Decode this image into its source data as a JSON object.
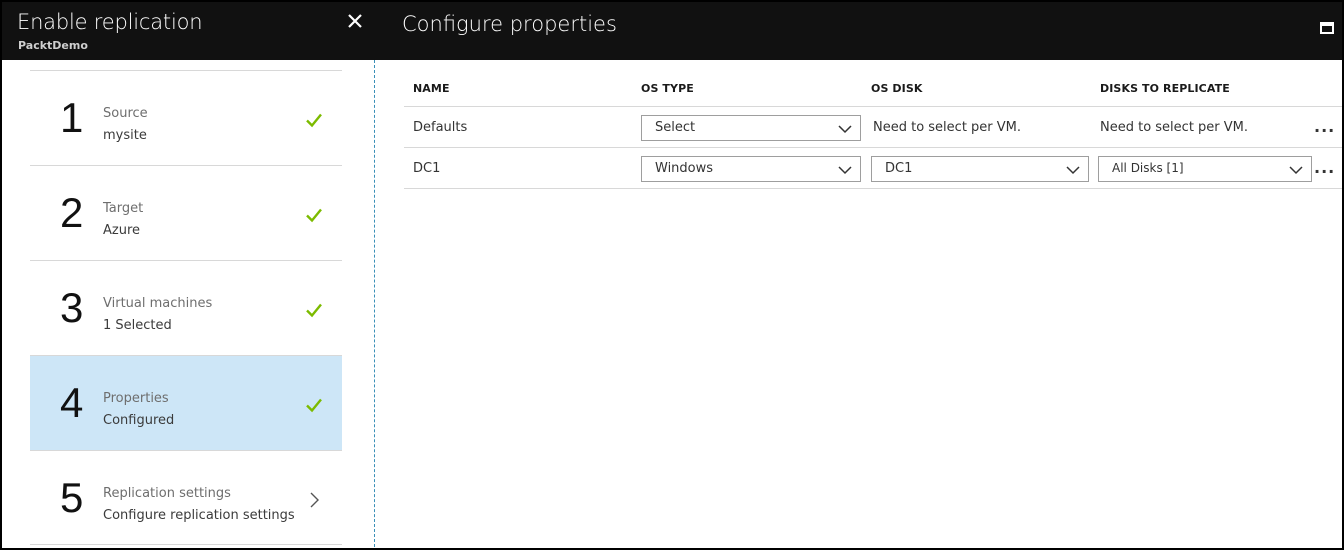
{
  "left_blade": {
    "title": "Enable replication",
    "subtitle": "PacktDemo",
    "close_icon": "close-icon",
    "steps": [
      {
        "number": "1",
        "label": "Source",
        "value": "mysite",
        "status": "done",
        "icon": "checkmark-icon"
      },
      {
        "number": "2",
        "label": "Target",
        "value": "Azure",
        "status": "done",
        "icon": "checkmark-icon"
      },
      {
        "number": "3",
        "label": "Virtual machines",
        "value": "1 Selected",
        "status": "done",
        "icon": "checkmark-icon"
      },
      {
        "number": "4",
        "label": "Properties",
        "value": "Configured",
        "status": "done",
        "active": true,
        "icon": "checkmark-icon"
      },
      {
        "number": "5",
        "label": "Replication settings",
        "value": "Configure replication settings",
        "status": "pending",
        "icon": "chevron-right-icon"
      }
    ]
  },
  "right_blade": {
    "title": "Configure properties",
    "maximize_icon": "maximize-icon",
    "columns": [
      "NAME",
      "OS TYPE",
      "OS DISK",
      "DISKS TO REPLICATE"
    ],
    "rows": [
      {
        "name": "Defaults",
        "os_type": "Select",
        "os_disk": "Need to select per VM.",
        "disks_to_replicate": "Need to select per VM.",
        "more": "..."
      },
      {
        "name": "DC1",
        "os_type": "Windows",
        "os_disk": "DC1",
        "disks_to_replicate": "All Disks [1]",
        "more": "..."
      }
    ]
  },
  "colors": {
    "header_bg": "#111111",
    "active_step_bg": "#cde6f7",
    "check_green": "#7cbb00",
    "divider": "#3a8fb7"
  }
}
